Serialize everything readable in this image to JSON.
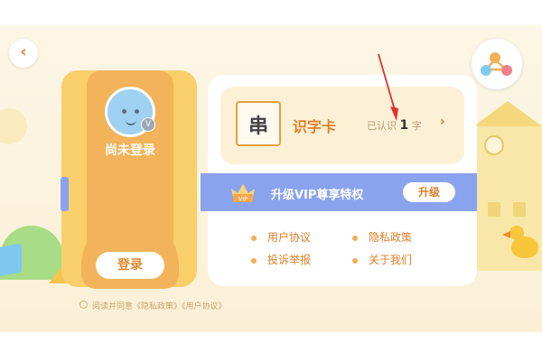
{
  "header": {
    "back_icon_glyph": "‹"
  },
  "profile": {
    "avatar_badge": "V",
    "status": "尚未登录",
    "login_label": "登录"
  },
  "flashcard": {
    "icon_char": "串",
    "title": "识字卡",
    "prefix": "已认识",
    "count": "1",
    "suffix": "字",
    "chevron": "›"
  },
  "vip": {
    "badge": "VIP",
    "text": "升级VIP尊享特权",
    "button_label": "升级"
  },
  "links": {
    "user_agreement": "用户协议",
    "privacy_policy": "隐私政策",
    "complaint_report": "投诉举报",
    "about_us": "关于我们"
  },
  "agreement_text": "阅读并同意《隐私政策》《用户协议》",
  "colors": {
    "accent_orange": "#e07f27",
    "vip_blue": "#8aa3ee",
    "card_yellow": "#f9cf6c"
  }
}
